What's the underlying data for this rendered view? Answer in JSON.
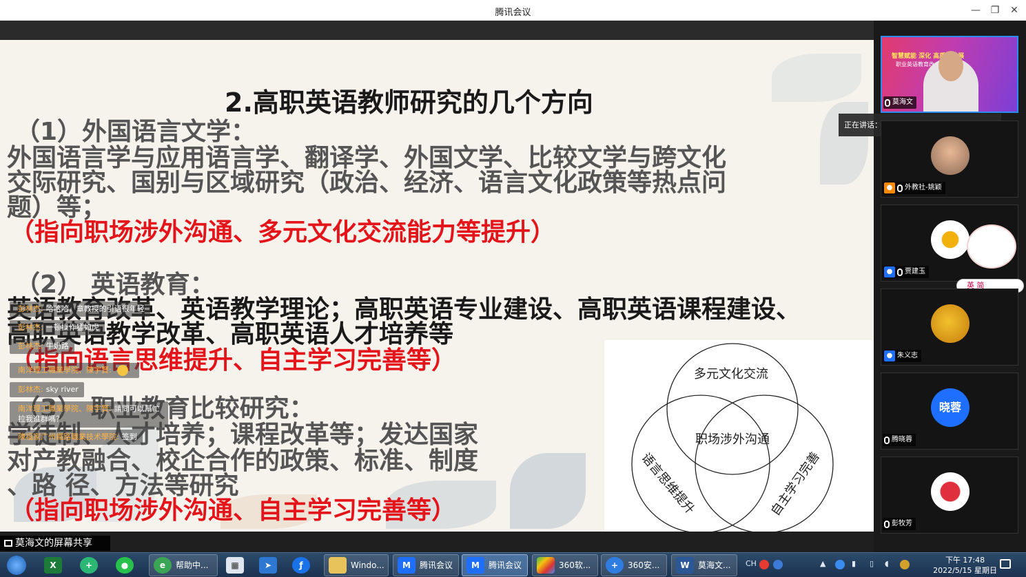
{
  "window": {
    "title": "腾讯会议",
    "minimize": "—",
    "restore": "❐",
    "close": "✕"
  },
  "slide": {
    "heading": "2.高职英语教师研究的几个方向",
    "s1_head": "（1）外国语言文学：",
    "s1_line1": "外国语言学与应用语言学、翻译学、外国文学、比较文学与跨文化",
    "s1_line2": "交际研究、国别与区域研究（政治、经济、语言文化政策等热点问",
    "s1_line3": "题）等；",
    "s1_red": "（指向职场涉外沟通、多元文化交流能力等提升）",
    "s2_head": "（2） 英语教育：",
    "s2_line1": "英语教育改革、英语教学理论；高职英语专业建设、高职英语课程建设、",
    "s2_line2": "高职英语教学改革、高职英语人才培养等",
    "s2_red": "（指向语言思维提升、自主学习完善等）",
    "s3_head": "（3） 职业教育比较研究：",
    "s3_line1": "学徒制、人才培养；课程改革等；发达国家",
    "s3_line2": "对产教融合、校企合作的政策、标准、制度",
    "s3_line3": "、路 径、方法等研究",
    "s3_red": "（指向职场涉外沟通、自主学习完善等）"
  },
  "venn": {
    "top": "多元文化交流",
    "center": "职场涉外沟通",
    "left": "语言思维提升",
    "right": "自主学习完善"
  },
  "danmaku": [
    {
      "name": "彭林杰:",
      "text": "哈哈哈，章教授的引语很年轻"
    },
    {
      "name": "彭林杰:",
      "text": "一顿操作猛如虎"
    },
    {
      "name": "彭林杰:",
      "text": "牛奶路"
    },
    {
      "name": "南洋理工職業學院、陳宇賢:",
      "text": ""
    },
    {
      "name": "彭林杰:",
      "text": "sky river"
    },
    {
      "name": "南洋理工職業學院、陳宇賢:",
      "text": "請問可以幫忙拉我進群嗎？"
    },
    {
      "name": "陳福家广州鐵路職業技术學院:",
      "text": "签到"
    }
  ],
  "participants": [
    {
      "name": "莫海文"
    },
    {
      "name": "外教社-姚颖"
    },
    {
      "name": "贾建玉"
    },
    {
      "name": "朱义志"
    },
    {
      "name": "腾晓蓉",
      "initials": "晓蓉"
    },
    {
      "name": "彭牧芳"
    }
  ],
  "poster": {
    "line1": "智慧赋能 深化   高质量发展",
    "line2": "职业英语教育改   发展研讨会"
  },
  "speaking": "正在讲话：莫海文;",
  "ime": "英 简",
  "share_label": "莫海文的屏幕共享",
  "taskbar": {
    "items": [
      {
        "label": "帮助中..."
      },
      {
        "label": "Windo..."
      },
      {
        "label": "腾讯会议"
      },
      {
        "label": "腾讯会议"
      },
      {
        "label": "360软..."
      },
      {
        "label": "360安..."
      },
      {
        "label": "莫海文..."
      }
    ],
    "time": "下午 17:48",
    "date": "2022/5/15 星期日",
    "ime_tray": "CH"
  }
}
